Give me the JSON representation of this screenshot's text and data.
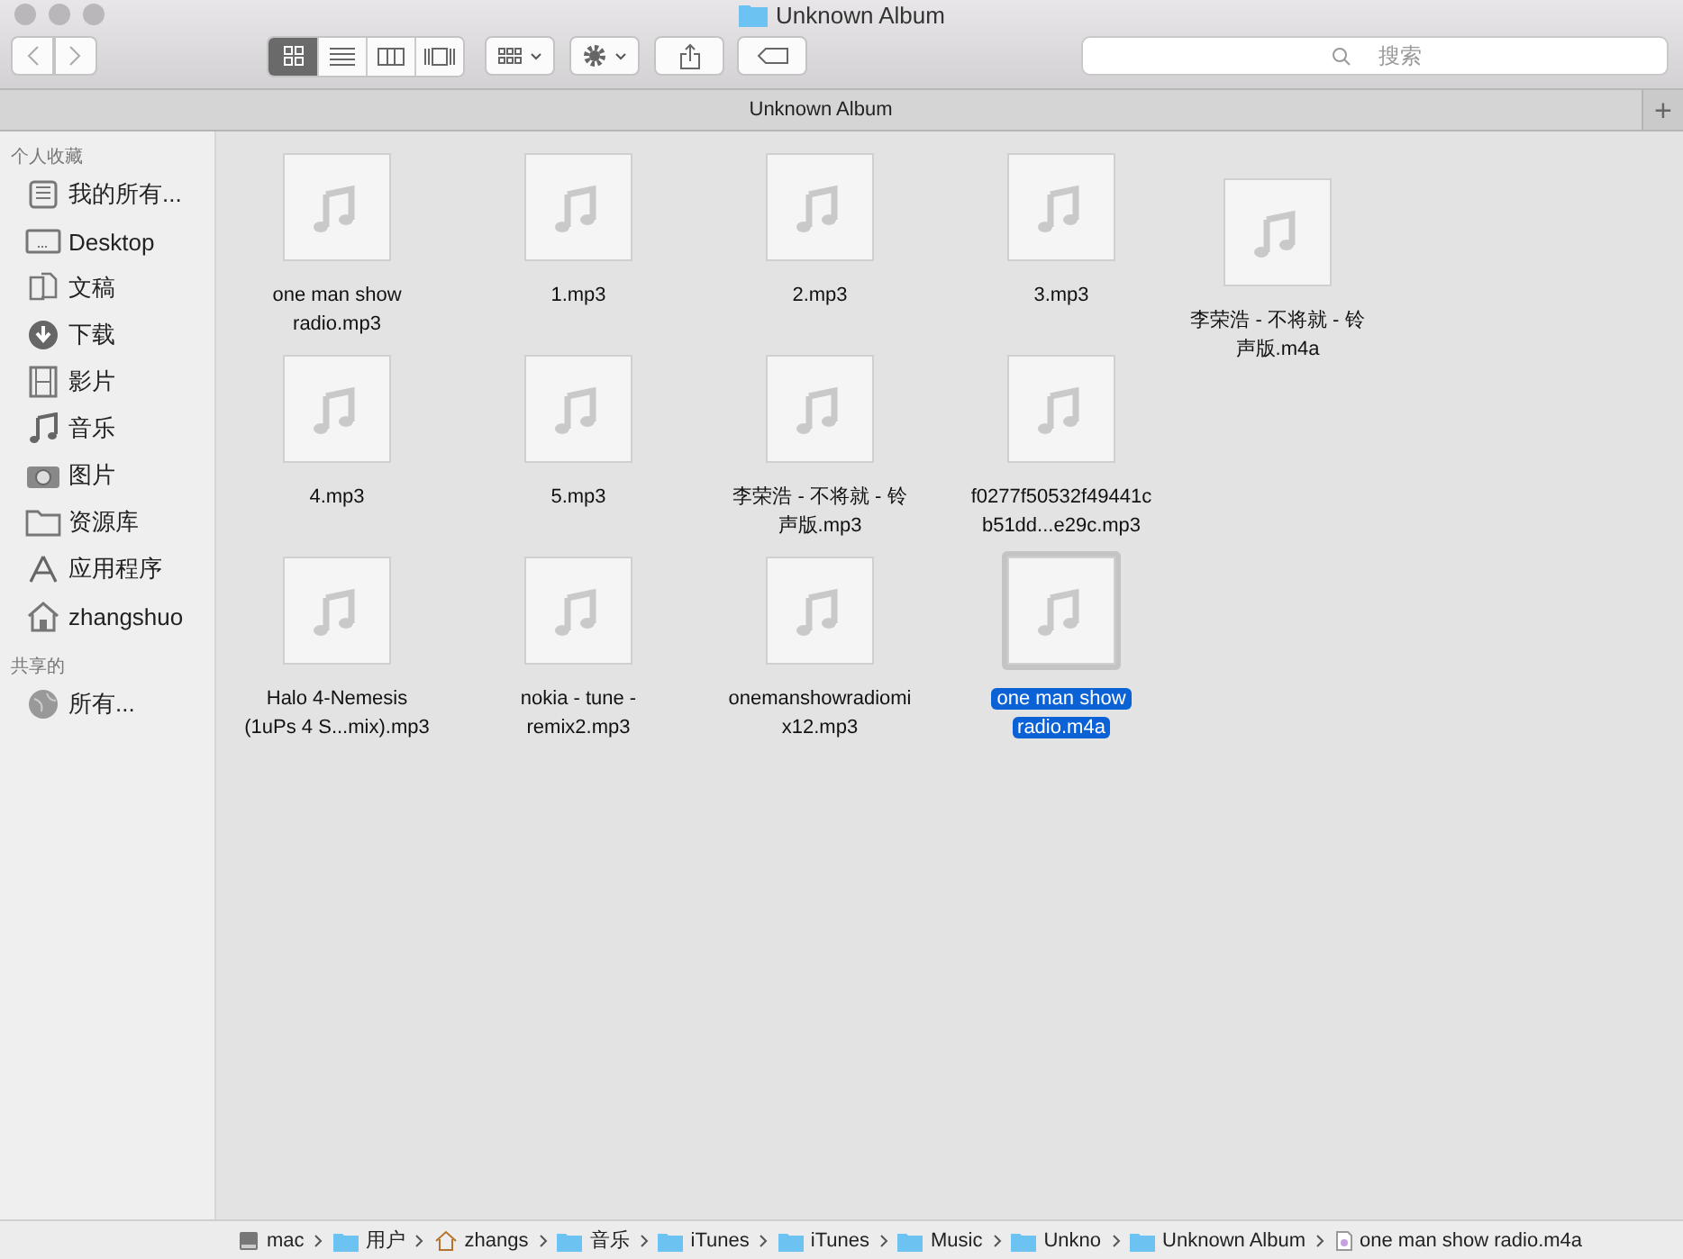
{
  "window": {
    "title": "Unknown Album"
  },
  "toolbar": {
    "view_modes": [
      {
        "kind": "icons",
        "selected": true
      },
      {
        "kind": "list",
        "selected": false
      },
      {
        "kind": "columns",
        "selected": false
      },
      {
        "kind": "coverflow",
        "selected": false
      }
    ],
    "search": {
      "placeholder": "搜索"
    }
  },
  "tab_bar": {
    "tabs": [
      {
        "label": "Unknown Album"
      }
    ],
    "new_tab": "+"
  },
  "sidebar": {
    "sections": [
      {
        "heading": "个人收藏",
        "items": [
          {
            "label": "我的所有...",
            "kind": "allfiles"
          },
          {
            "label": "Desktop",
            "kind": "desktop"
          },
          {
            "label": "文稿",
            "kind": "documents"
          },
          {
            "label": "下载",
            "kind": "downloads"
          },
          {
            "label": "影片",
            "kind": "movies"
          },
          {
            "label": "音乐",
            "kind": "music"
          },
          {
            "label": "图片",
            "kind": "pictures"
          },
          {
            "label": "资源库",
            "kind": "folder"
          },
          {
            "label": "应用程序",
            "kind": "apps"
          },
          {
            "label": "zhangshuo",
            "kind": "home"
          }
        ]
      },
      {
        "heading": "共享的",
        "items": [
          {
            "label": "所有...",
            "kind": "network"
          }
        ]
      }
    ]
  },
  "files": {
    "rows": [
      [
        {
          "name": "one man show radio.mp3",
          "selected": false
        },
        {
          "name": "1.mp3",
          "selected": false
        },
        {
          "name": "2.mp3",
          "selected": false
        },
        {
          "name": "3.mp3",
          "selected": false
        },
        {
          "name": "李荣浩 - 不将就 - 铃声版.m4a",
          "selected": false
        }
      ],
      [
        {
          "name": "4.mp3",
          "selected": false
        },
        {
          "name": "5.mp3",
          "selected": false
        },
        {
          "name": "李荣浩 - 不将就 - 铃声版.mp3",
          "selected": false
        },
        {
          "name": "f0277f50532f49441cb51dd...e29c.mp3",
          "selected": false
        }
      ],
      [
        {
          "name": "Halo 4-Nemesis (1uPs 4 S...mix).mp3",
          "selected": false
        },
        {
          "name": "nokia - tune - remix2.mp3",
          "selected": false
        },
        {
          "name": "onemanshowradiomix12.mp3",
          "selected": false
        },
        {
          "name": "one man show radio.m4a",
          "selected": true
        }
      ]
    ]
  },
  "path_bar": [
    {
      "label": "mac",
      "kind": "disk"
    },
    {
      "label": "用户",
      "kind": "userfolder"
    },
    {
      "label": "zhangs",
      "kind": "home"
    },
    {
      "label": "音乐",
      "kind": "musicfolder"
    },
    {
      "label": "iTunes",
      "kind": "folder"
    },
    {
      "label": "iTunes",
      "kind": "folder"
    },
    {
      "label": "Music",
      "kind": "folder"
    },
    {
      "label": "Unkno",
      "kind": "folder"
    },
    {
      "label": "Unknown Album",
      "kind": "folder"
    },
    {
      "label": "one man show radio.m4a",
      "kind": "file"
    }
  ]
}
